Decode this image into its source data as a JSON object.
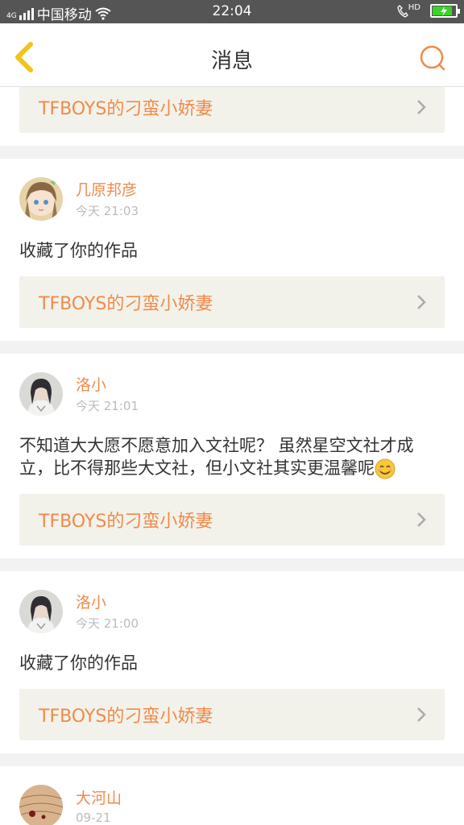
{
  "status_bar": {
    "carrier": "中国移动",
    "time": "22:04",
    "network": "4G",
    "hd": "HD"
  },
  "header": {
    "title": "消息"
  },
  "messages": [
    {
      "work_title": "TFBOYS的刁蛮小娇妻"
    },
    {
      "username": "几原邦彦",
      "time": "今天 21:03",
      "text": "收藏了你的作品",
      "work_title": "TFBOYS的刁蛮小娇妻",
      "avatar": "anime-girl-avatar"
    },
    {
      "username": "洛小",
      "time": "今天 21:01",
      "text": "不知道大大愿不愿意加入文社呢？ 虽然星空文社才成立，比不得那些大文社，但小文社其实更温馨呢",
      "work_title": "TFBOYS的刁蛮小娇妻",
      "avatar": "girl-photo-avatar"
    },
    {
      "username": "洛小",
      "time": "今天 21:00",
      "text": "收藏了你的作品",
      "work_title": "TFBOYS的刁蛮小娇妻",
      "avatar": "girl-photo-avatar"
    },
    {
      "username": "大河山",
      "time": "09-21",
      "avatar": "book-page-avatar"
    }
  ],
  "colors": {
    "accent": "#f08a4b",
    "back_icon": "#f0c419",
    "status_bar": "#555555",
    "link_bg": "#f3f2ea"
  }
}
